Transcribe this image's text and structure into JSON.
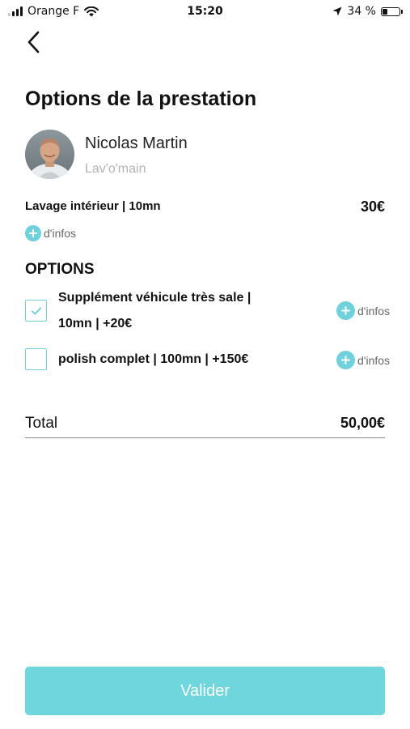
{
  "status_bar": {
    "carrier": "Orange F",
    "time": "15:20",
    "battery_text": "34 %",
    "battery_level": 0.34
  },
  "header": {
    "title": "Options de la prestation"
  },
  "provider": {
    "name": "Nicolas Martin",
    "company": "Lav'o'main"
  },
  "service": {
    "label": "Lavage intérieur | 10mn",
    "price": "30€",
    "info_label": "d'infos"
  },
  "options": {
    "heading": "OPTIONS",
    "items": [
      {
        "label_line1": "Supplément véhicule très sale |",
        "label_line2": "10mn | +20€",
        "checked": true,
        "info_label": "d'infos"
      },
      {
        "label_line1": "polish complet | 100mn | +150€",
        "checked": false,
        "info_label": "d'infos"
      }
    ]
  },
  "total": {
    "label": "Total",
    "value": "50,00€"
  },
  "actions": {
    "validate_label": "Valider"
  },
  "colors": {
    "accent": "#6fd1db",
    "button": "#6fd6de",
    "muted_text": "#b3b3b3"
  }
}
